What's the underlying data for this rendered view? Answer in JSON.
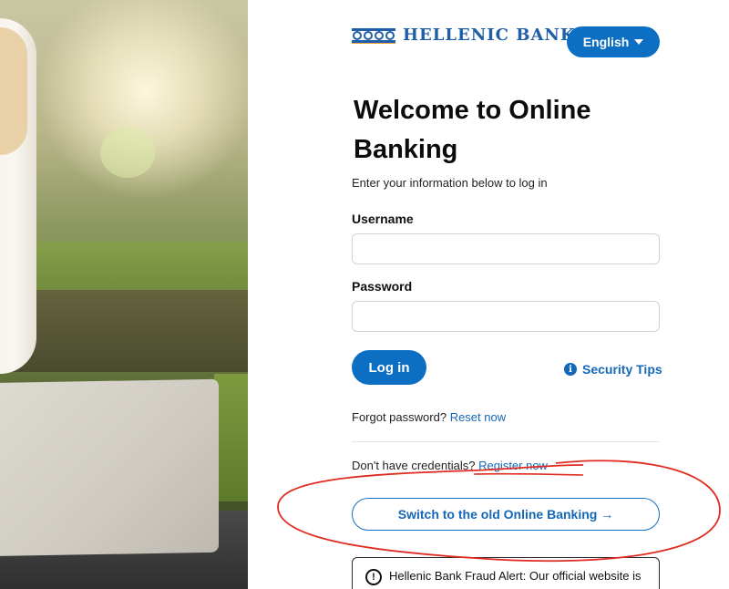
{
  "brand": {
    "name": "HELLENIC BANK",
    "logo_icon": "columns-logo-icon",
    "color": "#1f5fa8"
  },
  "language": {
    "selected": "English"
  },
  "form": {
    "title": "Welcome to Online Banking",
    "subtitle": "Enter your information below to log in",
    "username_label": "Username",
    "username_value": "",
    "password_label": "Password",
    "password_value": "",
    "login_label": "Log in",
    "security_tips_label": "Security Tips",
    "forgot_text": "Forgot password?",
    "reset_link": "Reset now",
    "register_text": "Don't have credentials?",
    "register_link": "Register now",
    "old_banking_label": "Switch to the old Online Banking →"
  },
  "alert": {
    "text": "Hellenic Bank Fraud Alert: Our official website is"
  },
  "colors": {
    "primary": "#0d6fc4",
    "link": "#1567b8",
    "annotation": "#e02b20"
  }
}
